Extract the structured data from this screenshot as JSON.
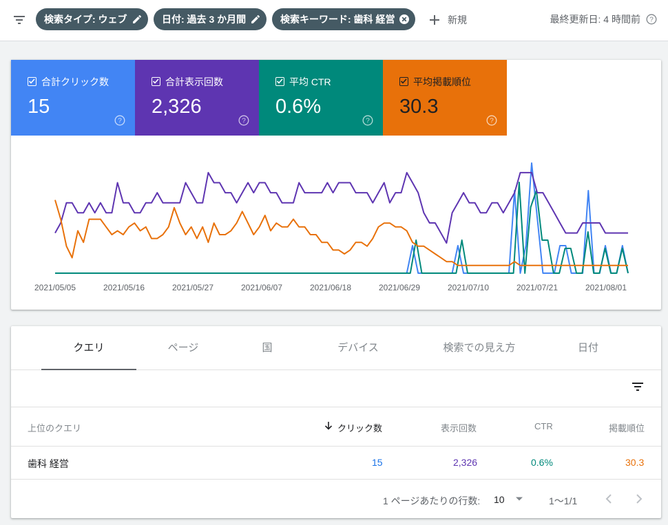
{
  "filters": {
    "chips": [
      {
        "label": "検索タイプ: ウェブ",
        "icon": "pencil-icon"
      },
      {
        "label": "日付: 過去 3 か月間",
        "icon": "pencil-icon"
      },
      {
        "label": "検索キーワード: 歯科 経営",
        "icon": "clear-icon"
      }
    ],
    "new_label": "新規",
    "last_updated": "最終更新日: 4 時間前"
  },
  "metrics": [
    {
      "label": "合計クリック数",
      "value": "15",
      "color": "#4285f4",
      "checked": true
    },
    {
      "label": "合計表示回数",
      "value": "2,326",
      "color": "#5e35b1",
      "checked": true
    },
    {
      "label": "平均 CTR",
      "value": "0.6%",
      "color": "#00897b",
      "checked": true
    },
    {
      "label": "平均掲載順位",
      "value": "30.3",
      "color": "#e8710a",
      "checked": true
    }
  ],
  "chart_data": {
    "type": "line",
    "x_tick_labels": [
      "2021/05/05",
      "2021/05/16",
      "2021/05/27",
      "2021/06/07",
      "2021/06/18",
      "2021/06/29",
      "2021/07/10",
      "2021/07/21",
      "2021/08/01"
    ],
    "y_axis_visible": false,
    "grid": false,
    "legend": "metric cards above chart",
    "series": [
      {
        "color": "#4285f4",
        "values": [
          0,
          0,
          0,
          0,
          0,
          0,
          0,
          0,
          0,
          0,
          0,
          0,
          0,
          0,
          0,
          0,
          0,
          0,
          0,
          0,
          0,
          0,
          0,
          0,
          0,
          0,
          0,
          0,
          0,
          0,
          0,
          0,
          0,
          0,
          0,
          0,
          0,
          0,
          0,
          0,
          0,
          0,
          0,
          0,
          0,
          0,
          0,
          0,
          0,
          0,
          0,
          0,
          0,
          0,
          0,
          0,
          0,
          0,
          0,
          0,
          0,
          0,
          0,
          1,
          0,
          0,
          0,
          0,
          0,
          0,
          0,
          1,
          0,
          0,
          0,
          0,
          0,
          0,
          0,
          0,
          0,
          3,
          0,
          1,
          4,
          2,
          0,
          0,
          0,
          1,
          1,
          0,
          0,
          0,
          3,
          0,
          0,
          1,
          0,
          0,
          1,
          0
        ]
      },
      {
        "color": "#00897b",
        "values": [
          0,
          0,
          0,
          0,
          0,
          0,
          0,
          0,
          0,
          0,
          0,
          0,
          0,
          0,
          0,
          0,
          0,
          0,
          0,
          0,
          0,
          0,
          0,
          0,
          0,
          0,
          0,
          0,
          0,
          0,
          0,
          0,
          0,
          0,
          0,
          0,
          0,
          0,
          0,
          0,
          0,
          0,
          0,
          0,
          0,
          0,
          0,
          0,
          0,
          0,
          0,
          0,
          0,
          0,
          0,
          0,
          0,
          0,
          0,
          0,
          0,
          0,
          0,
          4,
          0,
          0,
          0,
          0,
          0,
          0,
          0,
          4,
          0,
          0,
          0,
          0,
          0,
          0,
          0,
          0,
          0,
          11,
          0,
          8,
          10,
          4,
          4,
          0,
          0,
          3,
          3,
          0,
          0,
          5,
          0,
          0,
          3,
          0,
          0,
          3,
          0
        ]
      },
      {
        "color": "#5e35b1",
        "values": [
          1,
          1.1,
          1.3,
          1.3,
          1.2,
          1.2,
          1.3,
          1.2,
          1.3,
          1.2,
          1.2,
          1.5,
          1.3,
          1.3,
          1.2,
          1.2,
          1.3,
          1.3,
          1.4,
          1.3,
          1.3,
          1.3,
          1.3,
          1.5,
          1.4,
          1.3,
          1.3,
          1.6,
          1.5,
          1.5,
          1.4,
          1.4,
          1.3,
          1.4,
          1.5,
          1.4,
          1.5,
          1.5,
          1.4,
          1.4,
          1.3,
          1.3,
          1.3,
          1.5,
          1.4,
          1.4,
          1.4,
          1.4,
          1.5,
          1.4,
          1.5,
          1.5,
          1.5,
          1.4,
          1.4,
          1.4,
          1.3,
          1.4,
          1.5,
          1.3,
          1.4,
          1.4,
          1.6,
          1.5,
          1.4,
          1.2,
          1.1,
          1.1,
          1.0,
          0.9,
          1.2,
          1.3,
          1.4,
          1.3,
          1.3,
          1.2,
          1.2,
          1.3,
          1.3,
          1.2,
          1.3,
          1.4,
          1.6,
          1.6,
          1.6,
          1.4,
          1.4,
          1.3,
          1.2,
          1.1,
          1.0,
          1.0,
          1.0,
          1.1,
          1.1,
          1.1,
          1.1,
          1.0,
          1.0,
          1.0,
          1.0,
          1.0
        ]
      },
      {
        "color": "#e8710a",
        "values": [
          3.5,
          3,
          2.3,
          2,
          2.7,
          2.4,
          3,
          3,
          3,
          2.8,
          2.6,
          2.7,
          2.6,
          2.8,
          2.9,
          2.7,
          2.8,
          2.5,
          2.5,
          2.6,
          2.8,
          3.3,
          2.9,
          2.6,
          2.8,
          2.5,
          2.8,
          2.4,
          2.9,
          2.6,
          2.6,
          2.7,
          2.9,
          3.2,
          2.9,
          2.6,
          2.8,
          3.1,
          2.7,
          2.9,
          2.8,
          2.8,
          3,
          2.8,
          2.8,
          2.6,
          2.6,
          2.4,
          2.4,
          2.2,
          2.2,
          2.1,
          2.2,
          2.4,
          2.4,
          2.3,
          2.5,
          2.8,
          2.9,
          2.9,
          2.8,
          2.8,
          2.7,
          2.4,
          2.3,
          2.3,
          2.2,
          2.1,
          2.0,
          1.9,
          1.9,
          1.8,
          1.8,
          1.8,
          1.8,
          1.8,
          1.8,
          1.8,
          1.8,
          1.8,
          1.8,
          1.9,
          1.8,
          1.8,
          1.8,
          1.8,
          1.8,
          1.8,
          1.8,
          1.8,
          1.8,
          1.8,
          1.8,
          1.8,
          1.8,
          1.8,
          1.8,
          1.8,
          1.8,
          1.8,
          1.8,
          1.8
        ]
      }
    ]
  },
  "tabs": [
    "クエリ",
    "ページ",
    "国",
    "デバイス",
    "検索での見え方",
    "日付"
  ],
  "table": {
    "headers": {
      "query": "上位のクエリ",
      "clicks": "クリック数",
      "impressions": "表示回数",
      "ctr": "CTR",
      "position": "掲載順位"
    },
    "rows": [
      {
        "query": "歯科 経営",
        "clicks": "15",
        "impressions": "2,326",
        "ctr": "0.6%",
        "position": "30.3"
      }
    ],
    "pager": {
      "rows_label": "1 ページあたりの行数:",
      "rows_value": "10",
      "range": "1〜1/1"
    }
  }
}
